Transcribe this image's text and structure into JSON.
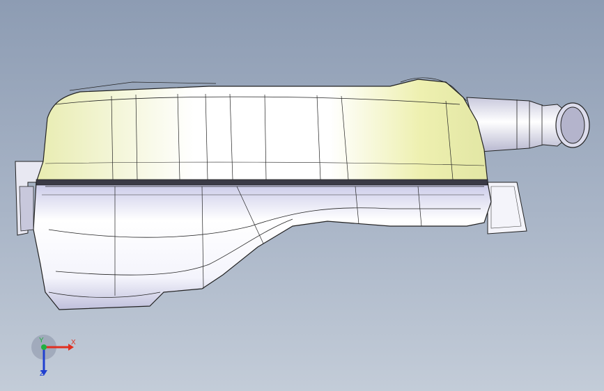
{
  "viewport": {
    "background_top": "#8d9cb3",
    "background_bottom": "#c3ccd8"
  },
  "model": {
    "upper_shell_color": "#f2f5c4",
    "lower_shell_color": "#dcdcf0",
    "edge_color": "#202020"
  },
  "triad": {
    "x_label": "X",
    "y_label": "Y",
    "z_label": "Z",
    "x_color": "#e03020",
    "y_color": "#20b040",
    "z_color": "#2040d0"
  }
}
